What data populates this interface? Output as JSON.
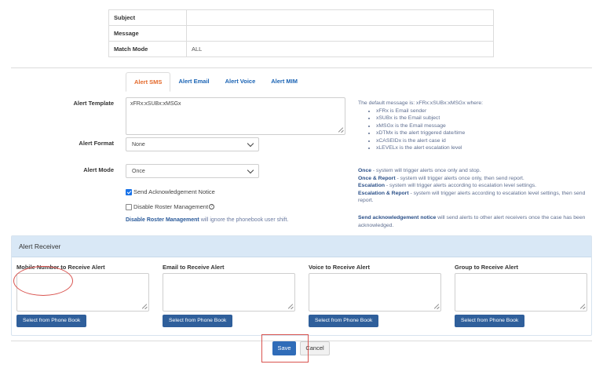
{
  "summary": {
    "rows": [
      {
        "key": "Subject",
        "value": ""
      },
      {
        "key": "Message",
        "value": ""
      },
      {
        "key": "Match Mode",
        "value": "ALL"
      }
    ]
  },
  "tabs": [
    {
      "label": "Alert SMS",
      "active": true
    },
    {
      "label": "Alert Email",
      "active": false
    },
    {
      "label": "Alert Voice",
      "active": false
    },
    {
      "label": "Alert MIM",
      "active": false
    }
  ],
  "template": {
    "label": "Alert Template",
    "value": "xFRx:xSUBx:xMSGx"
  },
  "template_help": {
    "intro": "The default message is: xFRx:xSUBx:xMSGx where:",
    "items": [
      "xFRx is Email sender",
      "xSUBx is the Email subject",
      "xMSGx is the Email message",
      "xDTMx is the alert triggered date/time",
      "xCASEIDx is the alert case id",
      "xLEVELx is the alert escalation level"
    ]
  },
  "format": {
    "label": "Alert Format",
    "value": "None"
  },
  "mode": {
    "label": "Alert Mode",
    "value": "Once"
  },
  "mode_help": [
    {
      "term": "Once",
      "text": " - system will trigger alerts once only and stop."
    },
    {
      "term": "Once & Report",
      "text": " - system will trigger alerts once only, then send report."
    },
    {
      "term": "Escalation",
      "text": " - system will trigger alerts according to escalation level settings."
    },
    {
      "term": "Escalation & Report",
      "text": " - system will trigger alerts according to escalation level settings, then send report."
    }
  ],
  "ack_help": {
    "term": "Send acknowledgement notice",
    "text": " will send alerts to other alert receivers once the case has been acknowledged."
  },
  "checks": {
    "ack_label": "Send Acknowledgement Notice",
    "ack_checked": true,
    "roster_label": "Disable Roster Management",
    "roster_checked": false,
    "roster_note_term": "Disable Roster Management",
    "roster_note_text": " will ignore the phonebook user shift."
  },
  "receiver": {
    "title": "Alert Receiver",
    "columns": [
      {
        "label": "Mobile Number to Receive Alert",
        "value": "",
        "button": "Select from Phone Book"
      },
      {
        "label": "Email to Receive Alert",
        "value": "",
        "button": "Select from Phone Book"
      },
      {
        "label": "Voice to Receive Alert",
        "value": "",
        "button": "Select from Phone Book"
      },
      {
        "label": "Group to Receive Alert",
        "value": "",
        "button": "Select from Phone Book"
      }
    ]
  },
  "actions": {
    "save": "Save",
    "cancel": "Cancel"
  },
  "colors": {
    "accent": "#2f6cb8",
    "tab_active": "#e46a2c",
    "highlight": "#d9534f"
  }
}
